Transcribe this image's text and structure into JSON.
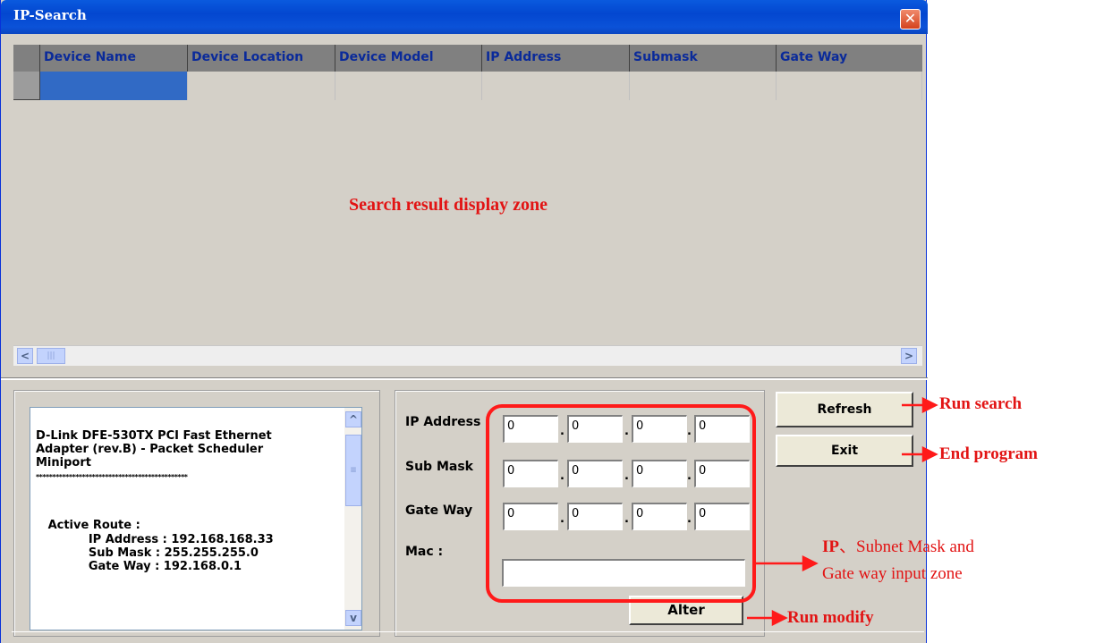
{
  "window": {
    "title": "IP-Search",
    "close_glyph": "✕"
  },
  "grid": {
    "columns": [
      "Device Name",
      "Device Location",
      "Device Model",
      "IP Address",
      "Submask",
      "Gate Way"
    ],
    "zone_label": "Search result display zone"
  },
  "scrollbar": {
    "left": "<",
    "right": ">",
    "thumb": "|||"
  },
  "adapter_info": {
    "lines": [
      "D-Link DFE-530TX PCI Fast Ethernet",
      "Adapter (rev.B) - Packet Scheduler",
      "Miniport",
      "**********************************************",
      "",
      "   Active Route :",
      "             IP Address : 192.168.168.33",
      "             Sub Mask : 255.255.255.0",
      "             Gate Way : 192.168.0.1"
    ]
  },
  "form": {
    "ip_label": "IP Address :",
    "submask_label": "Sub Mask",
    "gateway_label": "Gate Way",
    "mac_label": "Mac :",
    "ip_values": [
      "0",
      "0",
      "0",
      "0"
    ],
    "submask_values": [
      "0",
      "0",
      "0",
      "0"
    ],
    "gateway_values": [
      "0",
      "0",
      "0",
      "0"
    ],
    "mac_value": "",
    "dot": "."
  },
  "buttons": {
    "refresh": "Refresh",
    "exit": "Exit",
    "alter": "Alter"
  },
  "annotations": {
    "run_search": "Run search",
    "end_program": "End program",
    "input_zone_line1_ip": "IP",
    "input_zone_line1_rest": "、Subnet Mask and",
    "input_zone_line2": "Gate way input zone",
    "run_modify": "Run modify"
  },
  "colors": {
    "annotation": "#e21414",
    "header_text": "#0a2a9a",
    "title_bar": "#0347d0"
  }
}
